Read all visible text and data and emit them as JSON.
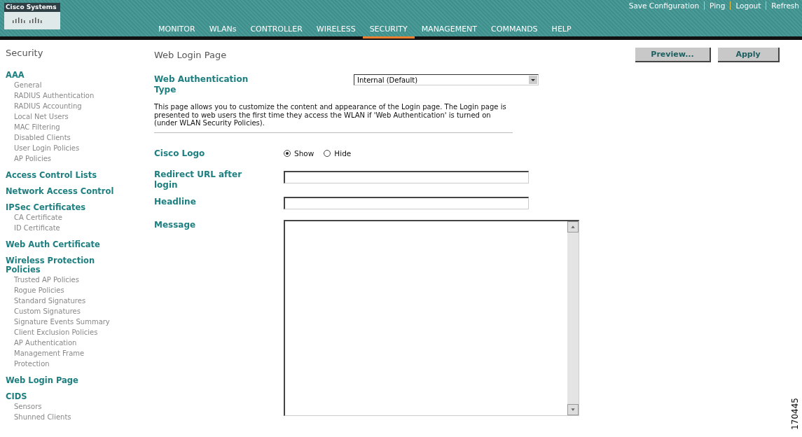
{
  "header": {
    "logo_text": "Cisco Systems",
    "top_links": [
      "Save Configuration",
      "Ping",
      "Logout",
      "Refresh"
    ],
    "tabs": [
      {
        "label": "MONITOR",
        "selected": false
      },
      {
        "label": "WLANs",
        "selected": false
      },
      {
        "label": "CONTROLLER",
        "selected": false
      },
      {
        "label": "WIRELESS",
        "selected": false
      },
      {
        "label": "SECURITY",
        "selected": true
      },
      {
        "label": "MANAGEMENT",
        "selected": false
      },
      {
        "label": "COMMANDS",
        "selected": false
      },
      {
        "label": "HELP",
        "selected": false
      }
    ]
  },
  "sidebar": {
    "title": "Security",
    "sections": [
      {
        "label": "AAA",
        "children": [
          {
            "label": "General"
          },
          {
            "label": "RADIUS Authentication"
          },
          {
            "label": "RADIUS Accounting"
          },
          {
            "label": "Local Net Users"
          },
          {
            "label": "MAC Filtering"
          },
          {
            "label": "Disabled Clients"
          },
          {
            "label": "User Login Policies"
          },
          {
            "label": "AP Policies"
          }
        ]
      },
      {
        "label": "Access Control Lists"
      },
      {
        "label": "Network Access Control"
      },
      {
        "label": "IPSec Certificates",
        "children": [
          {
            "label": "CA Certificate"
          },
          {
            "label": "ID Certificate"
          }
        ]
      },
      {
        "label": "Web Auth Certificate"
      },
      {
        "label": "Wireless Protection Policies",
        "children": [
          {
            "label": "Trusted AP Policies"
          },
          {
            "label": "Rogue Policies"
          },
          {
            "label": "Standard Signatures"
          },
          {
            "label": "Custom Signatures"
          },
          {
            "label": "Signature Events Summary"
          },
          {
            "label": "Client Exclusion Policies"
          },
          {
            "label": "AP Authentication"
          },
          {
            "label": "Management Frame Protection"
          }
        ]
      },
      {
        "label": "Web Login Page"
      },
      {
        "label": "CIDS",
        "children": [
          {
            "label": "Sensors"
          },
          {
            "label": "Shunned Clients"
          }
        ]
      }
    ]
  },
  "page": {
    "title": "Web Login Page",
    "buttons": [
      "Preview...",
      "Apply"
    ],
    "auth_type": {
      "label": "Web Authentication Type",
      "value": "Internal (Default)"
    },
    "description": "This page allows you to customize the content and appearance of the Login page. The Login page is presented to web users the first time they access the WLAN if 'Web Authentication' is turned on (under WLAN Security Policies).",
    "cisco_logo": {
      "label": "Cisco Logo",
      "options": [
        {
          "label": "Show",
          "selected": true
        },
        {
          "label": "Hide",
          "selected": false
        }
      ]
    },
    "redirect_url": {
      "label": "Redirect URL after login"
    },
    "headline": {
      "label": "Headline"
    },
    "message": {
      "label": "Message"
    }
  },
  "figure_number": "170445"
}
